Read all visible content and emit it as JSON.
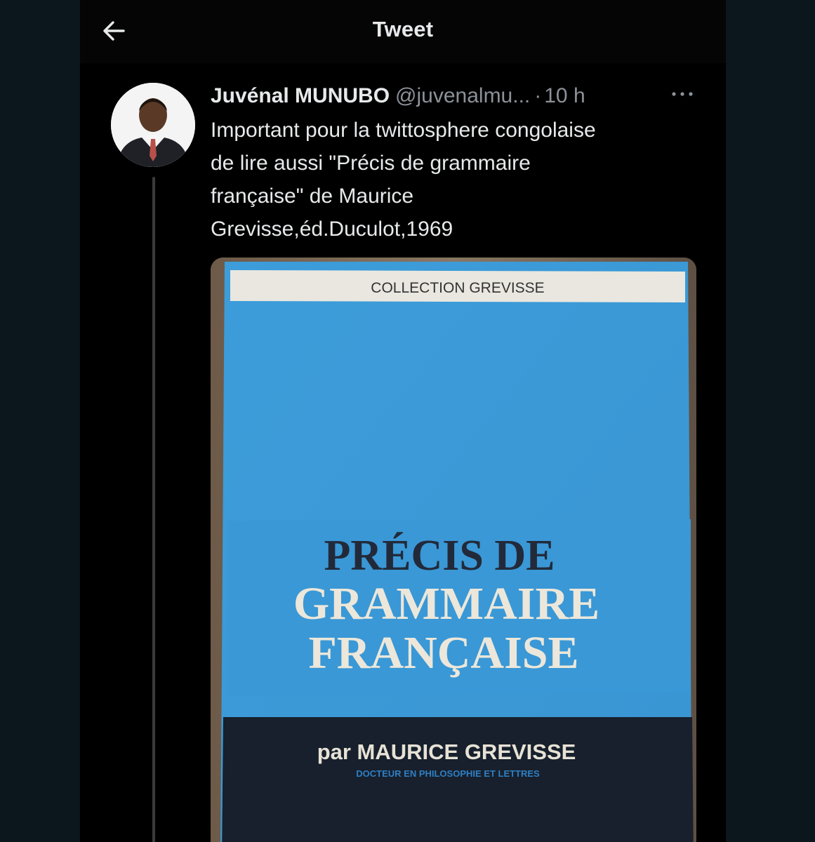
{
  "header": {
    "title": "Tweet",
    "back_icon": "arrow-left-icon"
  },
  "tweet": {
    "author_name": "Juvénal MUNUBO",
    "handle": "@juvenalmu...",
    "separator": "·",
    "time": "10 h",
    "more_icon": "more-horizontal-icon",
    "text_lines": [
      "Important pour la twittosphere congolaise",
      "de lire aussi \"Précis de grammaire",
      "française\" de Maurice",
      "Grevisse,éd.Duculot,1969"
    ]
  },
  "media": {
    "book_cover": {
      "collection": "COLLECTION  GREVISSE",
      "title_line_1": "PRÉCIS DE",
      "title_line_2": "GRAMMAIRE",
      "title_line_3": "FRANÇAISE",
      "author": "par MAURICE  GREVISSE",
      "subtitle": "DOCTEUR  EN  PHILOSOPHIE  ET  LETTRES",
      "cover_color": "#3b9ad6"
    }
  },
  "colors": {
    "background": "#000000",
    "outer_background": "#0c161d",
    "text_primary": "#e7e9ea",
    "text_secondary": "#8b9299"
  }
}
